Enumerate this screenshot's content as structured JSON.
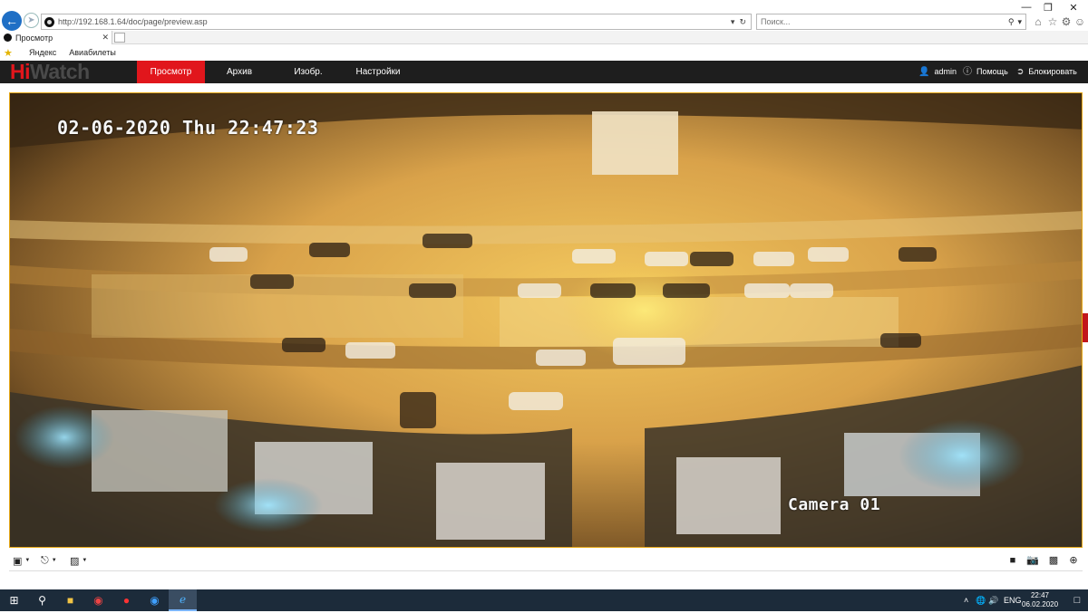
{
  "browser": {
    "url": "http://192.168.1.64/doc/page/preview.asp",
    "search_placeholder": "Поиск...",
    "tab_title": "Просмотр",
    "favorites": [
      "Яндекс",
      "Авиабилеты"
    ]
  },
  "app": {
    "logo_hi": "Hi",
    "logo_watch": "Watch",
    "menu": {
      "preview": "Просмотр",
      "archive": "Архив",
      "image": "Изобр.",
      "settings": "Настройки"
    },
    "user": "admin",
    "help": "Помощь",
    "lock": "Блокировать"
  },
  "video": {
    "osd_time": "02-06-2020 Thu 22:47:23",
    "osd_camera": "Camera 01"
  },
  "taskbar": {
    "lang": "ENG",
    "time": "22:47",
    "date": "06.02.2020"
  },
  "colors": {
    "brand_red": "#e1161c",
    "header_bg": "#1e1e1e",
    "video_border": "#e6a817"
  }
}
